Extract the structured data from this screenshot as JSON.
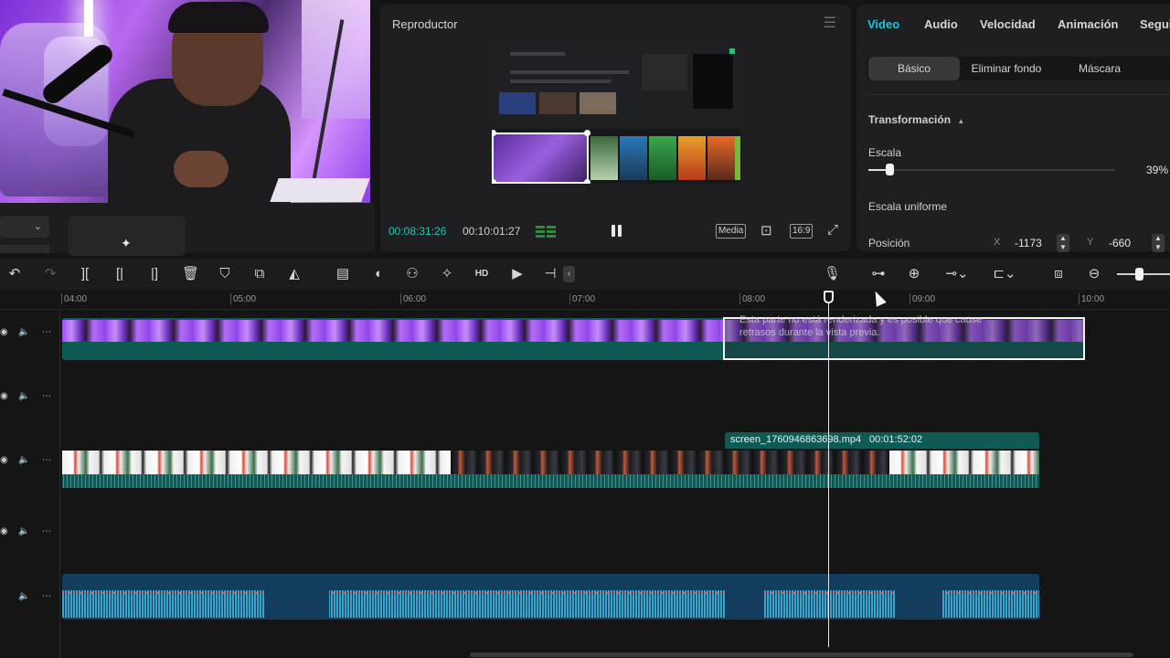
{
  "player": {
    "title": "Reproductor",
    "current_time": "00:08:31:26",
    "total_time": "00:10:01:27",
    "media_label": "Media",
    "ratio_label": "16:9"
  },
  "inspector": {
    "tabs": [
      "Video",
      "Audio",
      "Velocidad",
      "Animación",
      "Segui"
    ],
    "active_tab": "Video",
    "subtabs": [
      "Básico",
      "Eliminar fondo",
      "Máscara"
    ],
    "active_subtab": "Básico",
    "section_title": "Transformación",
    "scale_label": "Escala",
    "scale_value": "39%",
    "scale_fraction": 0.09,
    "uniform_scale_label": "Escala uniforme",
    "position_label": "Posición",
    "pos_x_label": "X",
    "pos_x_value": "-1173",
    "pos_y_label": "Y",
    "pos_y_value": "-660"
  },
  "toolbar": {
    "left_icons": [
      "undo-icon",
      "redo-icon",
      "split-icon",
      "split-left-icon",
      "split-right-icon",
      "delete-icon",
      "mark-icon",
      "crop-icon",
      "mirror-icon",
      "subtitle-icon",
      "audio-icon",
      "cutout-icon",
      "magic-icon",
      "hd-icon",
      "freeze-icon",
      "adjust-icon"
    ],
    "right_icons": [
      "mic-icon",
      "link-icon",
      "snap-icon",
      "chain-icon",
      "preview-axis-icon",
      "fit-icon",
      "zoom-out-icon"
    ]
  },
  "timeline": {
    "ruler": [
      "04:00",
      "05:00",
      "06:00",
      "07:00",
      "08:00",
      "09:00",
      "10:00"
    ],
    "render_warning": "Esta parte no está renderizada y es posible que cause retrasos durante la vista previa.",
    "screen_clip_name": "screen_1760946863698.mp4",
    "screen_clip_duration": "00:01:52:02"
  },
  "colors": {
    "accent": "#1ec8b4",
    "active_tab": "#21c4d8",
    "video_clip": "#0f5a55",
    "audio_clip": "#133d5c"
  }
}
